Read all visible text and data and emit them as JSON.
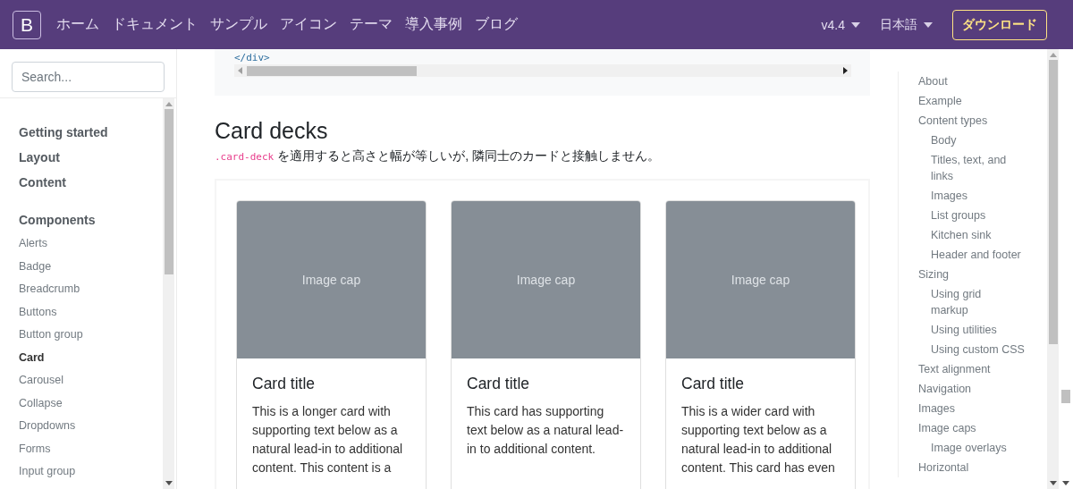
{
  "navbar": {
    "brand": "B",
    "links": [
      {
        "label": "ホーム"
      },
      {
        "label": "ドキュメント"
      },
      {
        "label": "サンプル"
      },
      {
        "label": "アイコン"
      },
      {
        "label": "テーマ"
      },
      {
        "label": "導入事例"
      },
      {
        "label": "ブログ"
      }
    ],
    "dropdowns": [
      {
        "label": "v4.4"
      },
      {
        "label": "日本語"
      }
    ],
    "download": "ダウンロード"
  },
  "sidebar": {
    "search": {
      "placeholder": "Search..."
    },
    "sections": [
      {
        "label": "Getting started"
      },
      {
        "label": "Layout"
      },
      {
        "label": "Content"
      },
      {
        "label": "Components",
        "items": [
          {
            "label": "Alerts",
            "selected": false
          },
          {
            "label": "Badge",
            "selected": false
          },
          {
            "label": "Breadcrumb",
            "selected": false
          },
          {
            "label": "Buttons",
            "selected": false
          },
          {
            "label": "Button group",
            "selected": false
          },
          {
            "label": "Card",
            "selected": true
          },
          {
            "label": "Carousel",
            "selected": false
          },
          {
            "label": "Collapse",
            "selected": false
          },
          {
            "label": "Dropdowns",
            "selected": false
          },
          {
            "label": "Forms",
            "selected": false
          },
          {
            "label": "Input group",
            "selected": false
          }
        ]
      }
    ]
  },
  "code_block": {
    "code": "</div>"
  },
  "section": {
    "title": "Card decks",
    "code": ".card-deck",
    "description": "を適用すると高さと幅が等しいが, 隣同士のカードと接触しません。"
  },
  "cards": [
    {
      "image_caption": "Image cap",
      "title": "Card title",
      "text": "This is a longer card with supporting text below as a natural lead-in to additional content. This content is a"
    },
    {
      "image_caption": "Image cap",
      "title": "Card title",
      "text": "This card has supporting text below as a natural lead-in to additional content."
    },
    {
      "image_caption": "Image cap",
      "title": "Card title",
      "text": "This is a wider card with supporting text below as a natural lead-in to additional content. This card has even"
    }
  ],
  "toc": [
    {
      "label": "About"
    },
    {
      "label": "Example"
    },
    {
      "label": "Content types",
      "children": [
        {
          "label": "Body"
        },
        {
          "label": "Titles, text, and links"
        },
        {
          "label": "Images"
        },
        {
          "label": "List groups"
        },
        {
          "label": "Kitchen sink"
        },
        {
          "label": "Header and footer"
        }
      ]
    },
    {
      "label": "Sizing",
      "children": [
        {
          "label": "Using grid markup"
        },
        {
          "label": "Using utilities"
        },
        {
          "label": "Using custom CSS"
        }
      ]
    },
    {
      "label": "Text alignment"
    },
    {
      "label": "Navigation"
    },
    {
      "label": "Images"
    },
    {
      "label": "Image caps",
      "children": [
        {
          "label": "Image overlays"
        }
      ]
    },
    {
      "label": "Horizontal"
    }
  ]
}
